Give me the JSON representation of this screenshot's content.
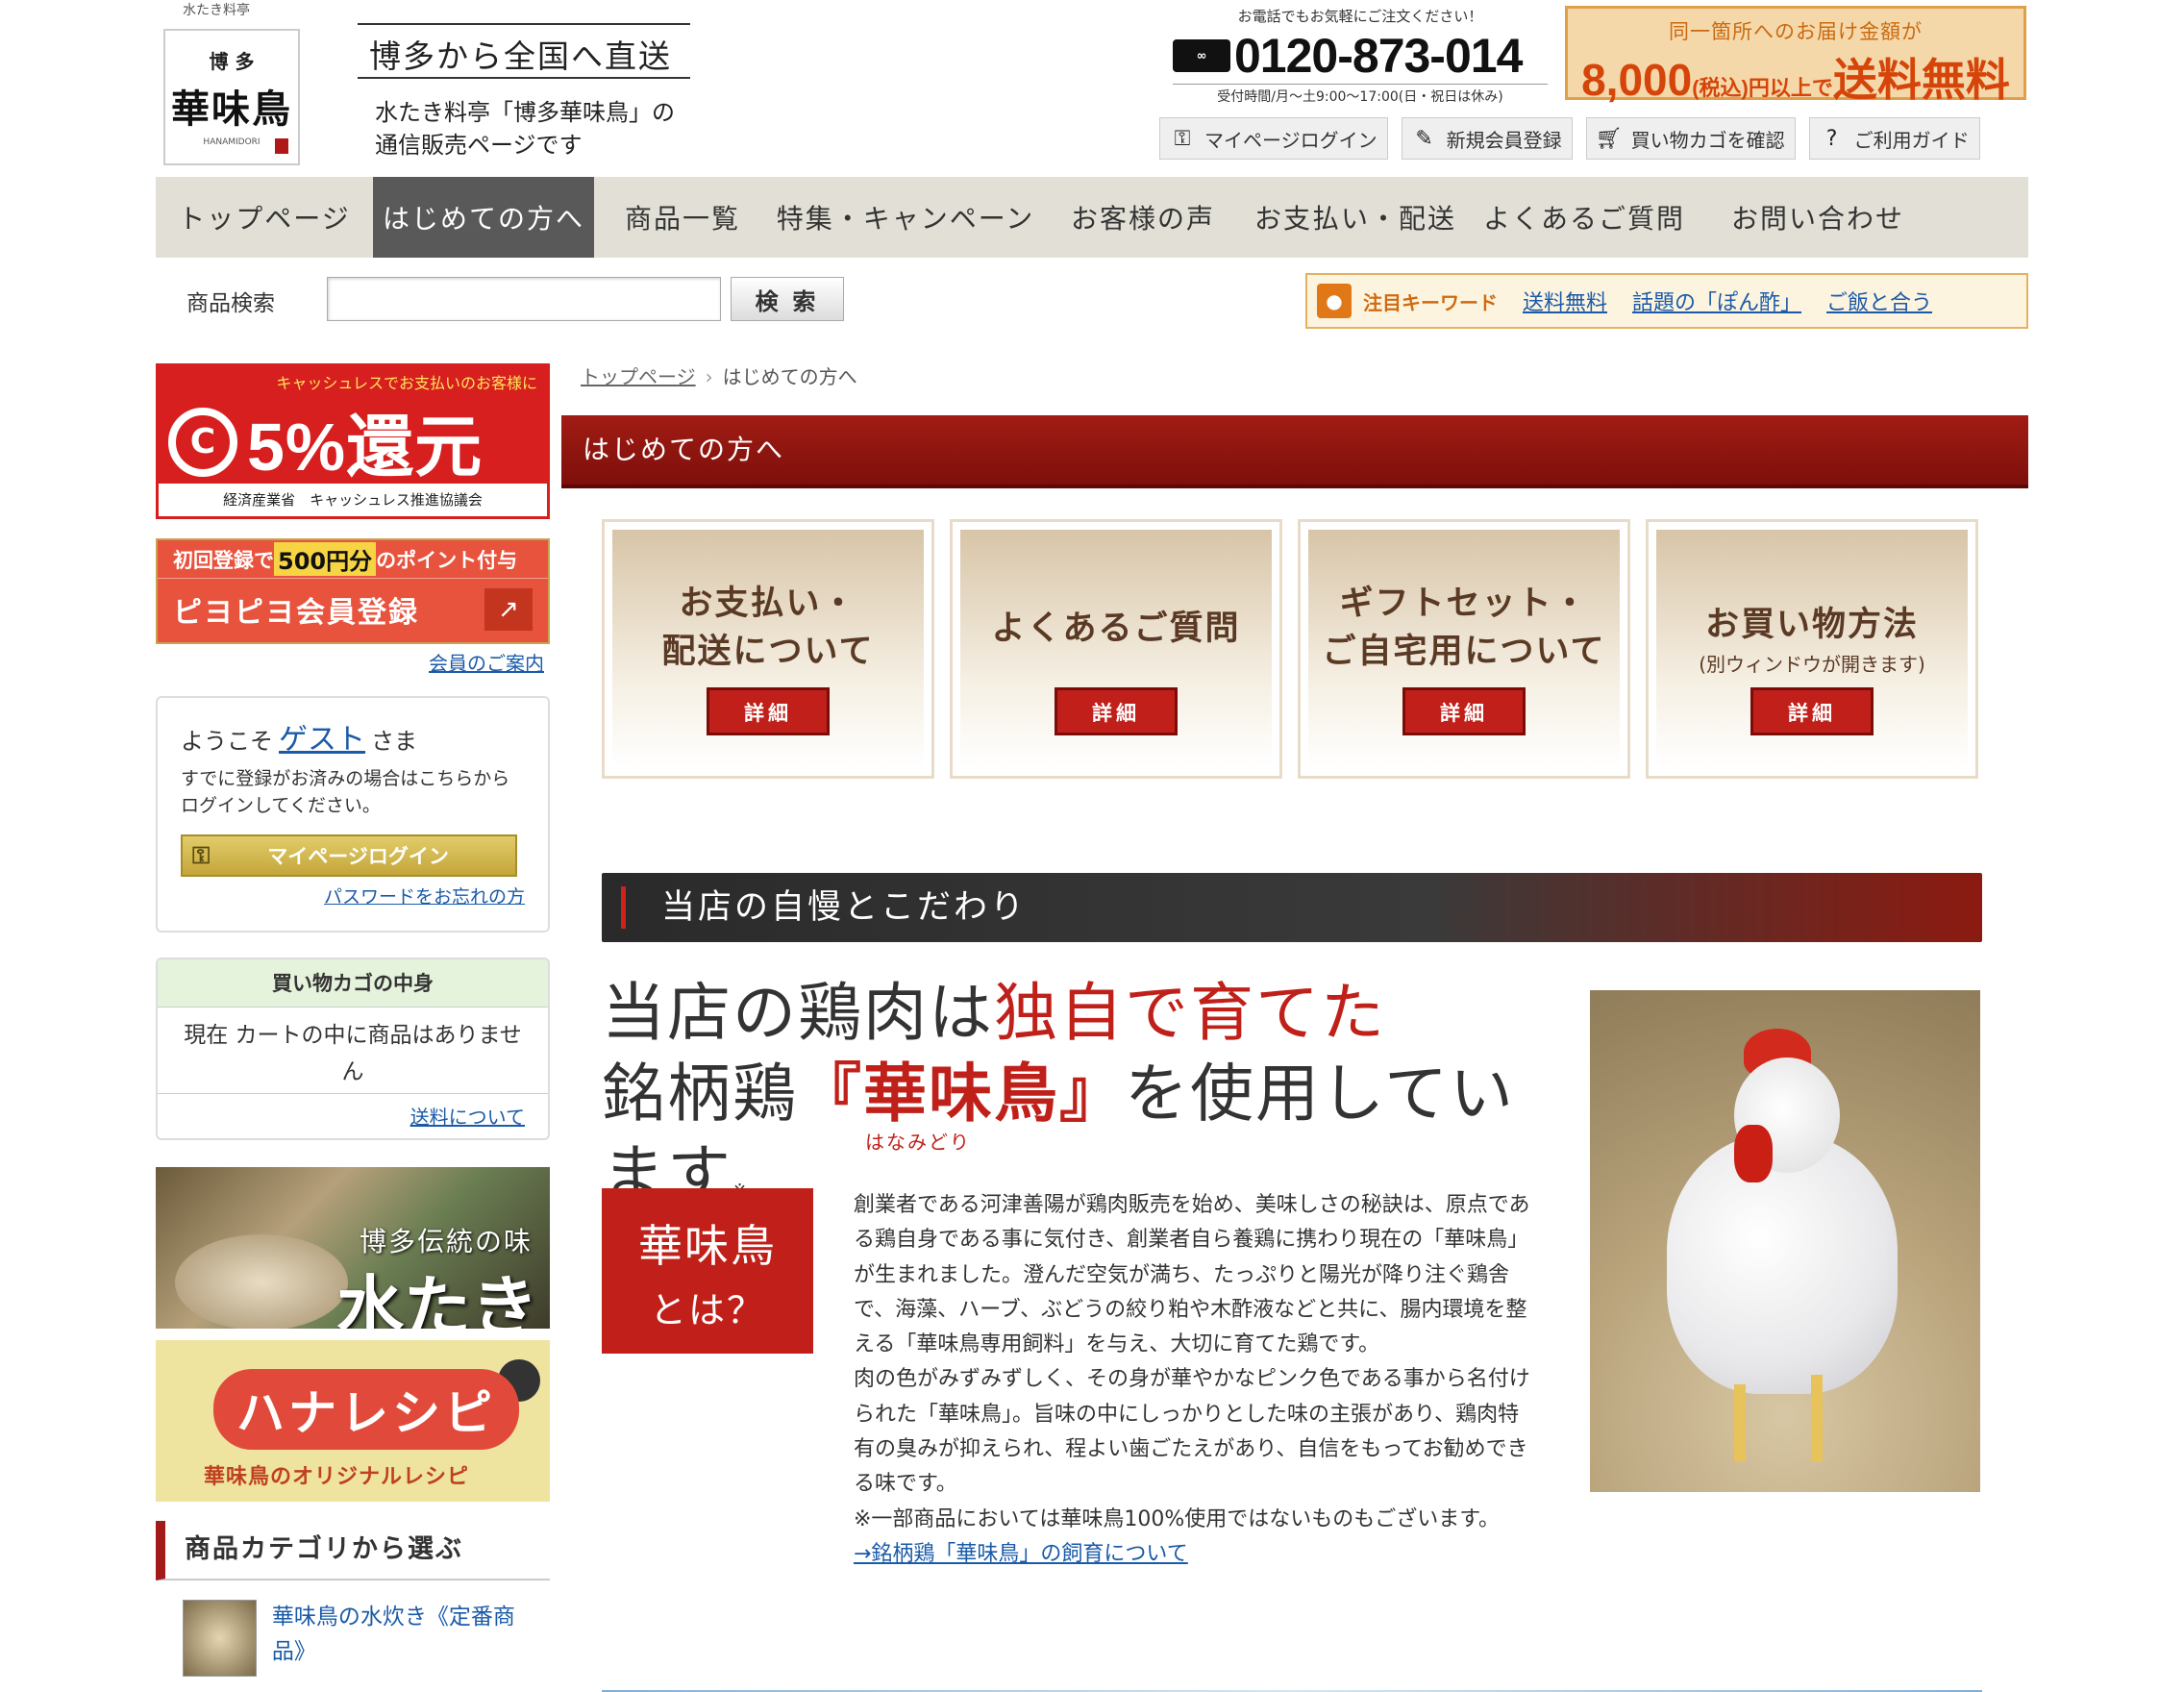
{
  "header": {
    "logo_top": "水たき料亭",
    "logo_sub": "博 多",
    "logo_name": "華味鳥",
    "logo_roman": "HANAMIDORI",
    "catch_title": "博多から全国へ直送",
    "catch_desc": "水たき料亭「博多華味鳥」の通信販売ページです",
    "phone_note": "お電話でもお気軽にご注文ください！",
    "freedial_icon": "free-dial-icon",
    "phone_number": "0120-873-014",
    "phone_hours": "受付時間/月〜土9:00〜17:00(日・祝日は休み)",
    "freeship_top": "同一箇所へのお届け金額が",
    "freeship_amount": "8,000",
    "freeship_tax": "(税込)",
    "freeship_suffix": "円以上で",
    "freeship_label": "送料無料",
    "util_nav": [
      {
        "label": "マイページログイン",
        "icon": "key-icon"
      },
      {
        "label": "新規会員登録",
        "icon": "pen-icon"
      },
      {
        "label": "買い物カゴを確認",
        "icon": "cart-icon"
      },
      {
        "label": "ご利用ガイド",
        "icon": "question-icon"
      }
    ]
  },
  "global_nav": [
    {
      "label": "トップページ",
      "active": false
    },
    {
      "label": "はじめての方へ",
      "active": true
    },
    {
      "label": "商品一覧",
      "active": false
    },
    {
      "label": "特集・キャンペーン",
      "active": false
    },
    {
      "label": "お客様の声",
      "active": false
    },
    {
      "label": "お支払い・配送",
      "active": false
    },
    {
      "label": "よくあるご質問",
      "active": false
    },
    {
      "label": "お問い合わせ",
      "active": false
    }
  ],
  "search": {
    "label": "商品検索",
    "value": "",
    "button": "検 索"
  },
  "keywords": {
    "icon": "speech-bubble-icon",
    "label": "注目キーワード",
    "links": [
      "送料無料",
      "話題の「ぽん酢」",
      "ご飯と合う"
    ]
  },
  "sidebar": {
    "cashless_top": "キャッシュレスでお支払いのお客様に",
    "cashless_main": "5%還元",
    "cashless_bottom": "経済産業省　キャッシュレス推進協議会",
    "member_prefix": "初回登録で",
    "member_points": "500円分",
    "member_suffix": "のポイント付与",
    "member_label": "ピヨピヨ会員登録",
    "member_guide": "会員のご案内",
    "welcome_prefix": "ようこそ",
    "welcome_guest": "ゲスト",
    "welcome_suffix": "さま",
    "welcome_msg": "すでに登録がお済みの場合はこちらからログインしてください。",
    "mypage_login": "マイページログイン",
    "forgot_password": "パスワードをお忘れの方",
    "cart_head": "買い物カゴの中身",
    "cart_msg": "現在 カートの中に商品はありません",
    "cart_ship": "送料について",
    "mizutaki_small": "博多伝統の味",
    "mizutaki_big": "水たき",
    "recipe_title": "ハナレシピ",
    "recipe_sub": "華味鳥のオリジナルレシピ",
    "category_heading": "商品カテゴリから選ぶ",
    "category_item": "華味鳥の水炊き《定番商品》"
  },
  "main": {
    "breadcrumb": [
      "トップページ",
      "はじめての方へ"
    ],
    "page_title": "はじめての方へ",
    "cards": [
      {
        "line1": "お支払い・",
        "line2": "配送について",
        "sub": "",
        "button": "詳細"
      },
      {
        "line1": "よくあるご質問",
        "line2": "",
        "sub": "",
        "button": "詳細"
      },
      {
        "line1": "ギフトセット・",
        "line2": "ご自宅用について",
        "sub": "",
        "button": "詳細"
      },
      {
        "line1": "お買い物方法",
        "line2": "",
        "sub": "(別ウィンドウが開きます)",
        "button": "詳細"
      }
    ],
    "section_title": "当店の自慢とこだわり",
    "headline_1a": "当店の鶏肉は",
    "headline_1b": "独自で育てた",
    "headline_2a": "銘柄鶏",
    "headline_2b": "『華味鳥』",
    "headline_2c": "を使用しています",
    "headline_note": "※",
    "headline_ruby": "はなみどり",
    "what_title": "華味鳥",
    "what_sub": "とは？",
    "intro_p1": "創業者である河津善陽が鶏肉販売を始め、美味しさの秘訣は、原点である鶏自身である事に気付き、創業者自ら養鶏に携わり現在の「華味鳥」が生まれました。澄んだ空気が満ち、たっぷりと陽光が降り注ぐ鶏舎で、海藻、ハーブ、ぶどうの絞り粕や木酢液などと共に、腸内環境を整える「華味鳥専用飼料」を与え、大切に育てた鶏です。",
    "intro_p2": "肉の色がみずみずしく、その身が華やかなピンク色である事から名付けられた「華味鳥」。旨味の中にしっかりとした味の主張があり、鶏肉特有の臭みが抑えられ、程よい歯ごたえがあり、自信をもってお勧めできる味です。",
    "intro_note": "※一部商品においては華味鳥100%使用ではないものもございます。",
    "intro_link": "→銘柄鶏「華味鳥」の飼育について"
  },
  "colors": {
    "brand_red": "#c1201a",
    "nav_bg": "#e2e0d6",
    "nav_active": "#595959",
    "link": "#1a5aa8"
  }
}
